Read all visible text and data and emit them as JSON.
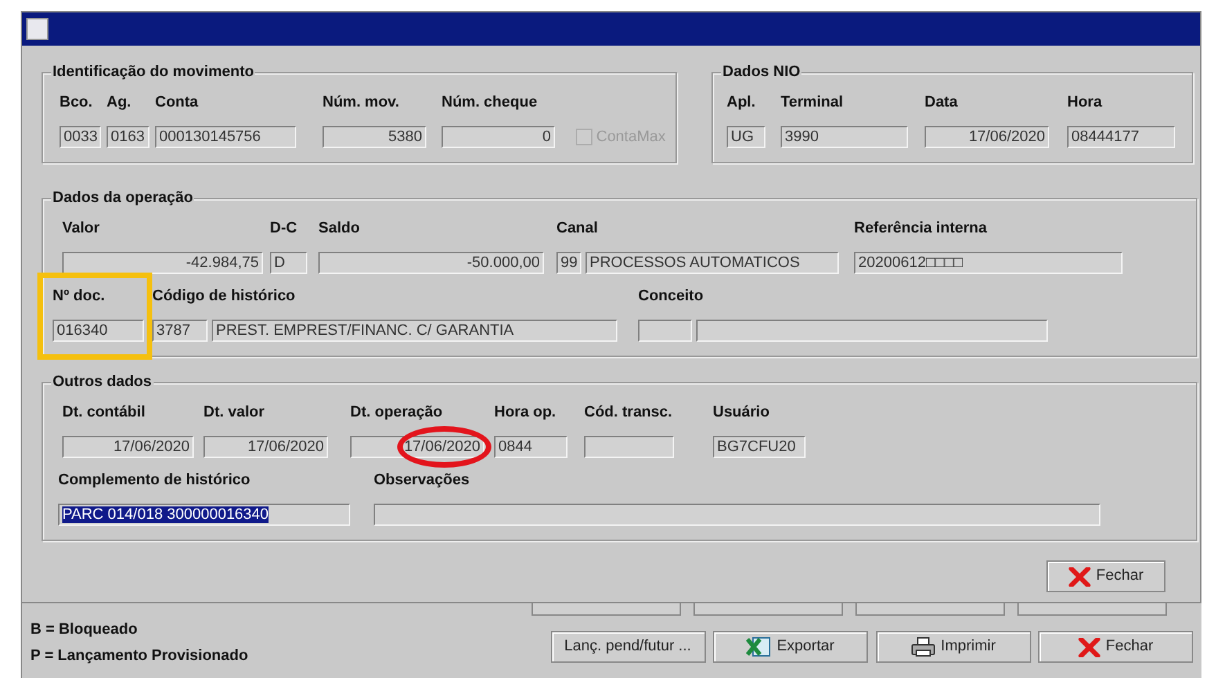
{
  "identificacao": {
    "title": "Identificação do movimento",
    "fields": [
      {
        "label": "Bco.",
        "boxes": [
          {
            "value": "0033"
          }
        ]
      },
      {
        "label": "Ag.",
        "boxes": [
          {
            "value": "0163"
          }
        ]
      },
      {
        "label": "Conta",
        "boxes": [
          {
            "value": "000130145756"
          }
        ]
      },
      {
        "label": "Núm. mov.",
        "boxes": [
          {
            "value": "5380"
          }
        ]
      },
      {
        "label": "Núm. cheque",
        "boxes": [
          {
            "value": "0"
          }
        ]
      }
    ],
    "checkbox": {
      "label": "ContaMax",
      "checked": false,
      "disabled": true
    }
  },
  "dados_nio": {
    "title": "Dados NIO",
    "fields": [
      {
        "label": "Apl.",
        "boxes": [
          {
            "value": "UG"
          }
        ]
      },
      {
        "label": "Terminal",
        "boxes": [
          {
            "value": "3990"
          }
        ]
      },
      {
        "label": "Data",
        "boxes": [
          {
            "value": "17/06/2020"
          }
        ]
      },
      {
        "label": "Hora",
        "boxes": [
          {
            "value": "08444177"
          }
        ]
      }
    ]
  },
  "dados_operacao": {
    "title": "Dados da operação",
    "fields": [
      {
        "label": "Valor",
        "boxes": [
          {
            "value": "-42.984,75"
          }
        ]
      },
      {
        "label": "D-C",
        "boxes": [
          {
            "value": "D"
          }
        ]
      },
      {
        "label": "Saldo",
        "boxes": [
          {
            "value": "-50.000,00"
          }
        ]
      },
      {
        "label": "Canal",
        "boxes": [
          {
            "value": "99"
          },
          {
            "value": "PROCESSOS AUTOMATICOS"
          }
        ]
      },
      {
        "label": "Referência interna",
        "boxes": [
          {
            "value": "20200612□□□□"
          }
        ]
      },
      {
        "label": "Nº doc.",
        "boxes": [
          {
            "value": "016340"
          }
        ]
      },
      {
        "label": "Código de histórico",
        "boxes": [
          {
            "value": "3787"
          },
          {
            "value": "PREST. EMPREST/FINANC. C/ GARANTIA"
          }
        ]
      },
      {
        "label": "Conceito",
        "boxes": [
          {
            "kind": "empty"
          },
          {
            "kind": "empty"
          }
        ]
      }
    ]
  },
  "outros_dados": {
    "title": "Outros dados",
    "fields": [
      {
        "label": "Dt. contábil",
        "boxes": [
          {
            "value": "17/06/2020"
          }
        ]
      },
      {
        "label": "Dt. valor",
        "boxes": [
          {
            "value": "17/06/2020"
          }
        ]
      },
      {
        "label": "Dt. operação",
        "boxes": [
          {
            "value": "17/06/2020"
          }
        ]
      },
      {
        "label": "Hora op.",
        "boxes": [
          {
            "value": "0844"
          }
        ]
      },
      {
        "label": "Cód. transc.",
        "boxes": [
          {
            "kind": "empty"
          }
        ]
      },
      {
        "label": "Usuário",
        "boxes": [
          {
            "value": "BG7CFU20"
          }
        ]
      },
      {
        "label": "Complemento de histórico",
        "boxes": [
          {
            "value": "PARC 014/018 300000016340",
            "text_selected": true
          }
        ]
      },
      {
        "label": "Observações",
        "boxes": [
          {
            "kind": "empty"
          }
        ]
      }
    ]
  },
  "close_button": {
    "label": "Fechar"
  },
  "partial_fields": [
    {
      "kind": "field"
    },
    {
      "kind": "field"
    },
    {
      "kind": "field"
    },
    {
      "kind": "field"
    }
  ],
  "legend": [
    "B = Bloqueado",
    "P = Lançamento Provisionado"
  ],
  "buttons": [
    {
      "label": "Lanç. pend/futur ..."
    },
    {
      "label": "Exportar"
    },
    {
      "label": "Imprimir"
    },
    {
      "label": "Fechar"
    }
  ]
}
